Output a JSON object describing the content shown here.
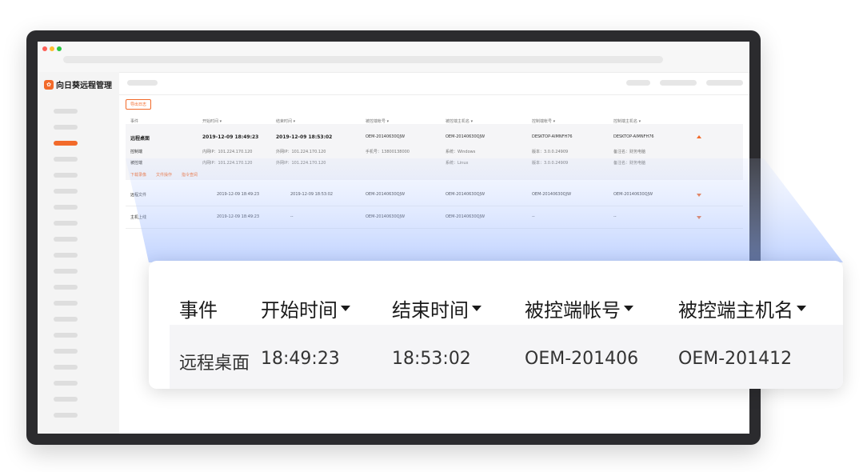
{
  "app": {
    "title": "向日葵远程管理",
    "logo_icon": "sunflower-logo-icon",
    "accent": "#f26a2a"
  },
  "toolbar": {
    "export_label": "导出日志"
  },
  "table": {
    "columns": [
      "事件",
      "开始时间",
      "结束时间",
      "被控端帐号",
      "被控端主机名",
      "控制端帐号",
      "控制端主机名"
    ],
    "expanded_row": {
      "event": "远程桌面",
      "start": "2019-12-09 18:49:23",
      "end": "2019-12-09 18:53:02",
      "controlled_account": "OEM-20140630QJW",
      "controlled_host": "OEM-20140630QJW",
      "controller_account": "DESKTOP-AIMNFH76",
      "controller_host": "DESKTOP-AIMNFH76",
      "details": [
        {
          "label": "控制端",
          "ip1": "内网IP：101.224.170.120",
          "ip2": "外网IP：101.224.170.120",
          "phone": "手机号：13800138000",
          "os": "系统：Windows",
          "version": "版本：3.0.0.24909",
          "remark": "备注名：财务电脑"
        },
        {
          "label": "被控端",
          "ip1": "内网IP：101.224.170.120",
          "ip2": "外网IP：101.224.170.120",
          "phone": "",
          "os": "系统：Linux",
          "version": "版本：3.0.0.24909",
          "remark": "备注名：财务电脑"
        }
      ],
      "actions": [
        "下载录像",
        "文件操作",
        "指令查阅"
      ]
    },
    "rows": [
      {
        "event": "远程文件",
        "start": "2019-12-09 18:49:23",
        "end": "2019-12-09 18:53:02",
        "controlled_account": "OEM-20140630QJW",
        "controlled_host": "OEM-20140630QJW",
        "controller_account": "OEM-20140630QJW",
        "controller_host": "OEM-20140630QJW"
      },
      {
        "event": "主机上线",
        "start": "2019-12-09 18:49:23",
        "end": "--",
        "controlled_account": "OEM-20140630QJW",
        "controlled_host": "OEM-20140630QJW",
        "controller_account": "--",
        "controller_host": "--"
      }
    ]
  },
  "zoom": {
    "headers": [
      "事件",
      "开始时间",
      "结束时间",
      "被控端帐号",
      "被控端主机名"
    ],
    "cells": [
      "远程桌面",
      "18:49:23",
      "18:53:02",
      "OEM-201406",
      "OEM-201412"
    ]
  }
}
